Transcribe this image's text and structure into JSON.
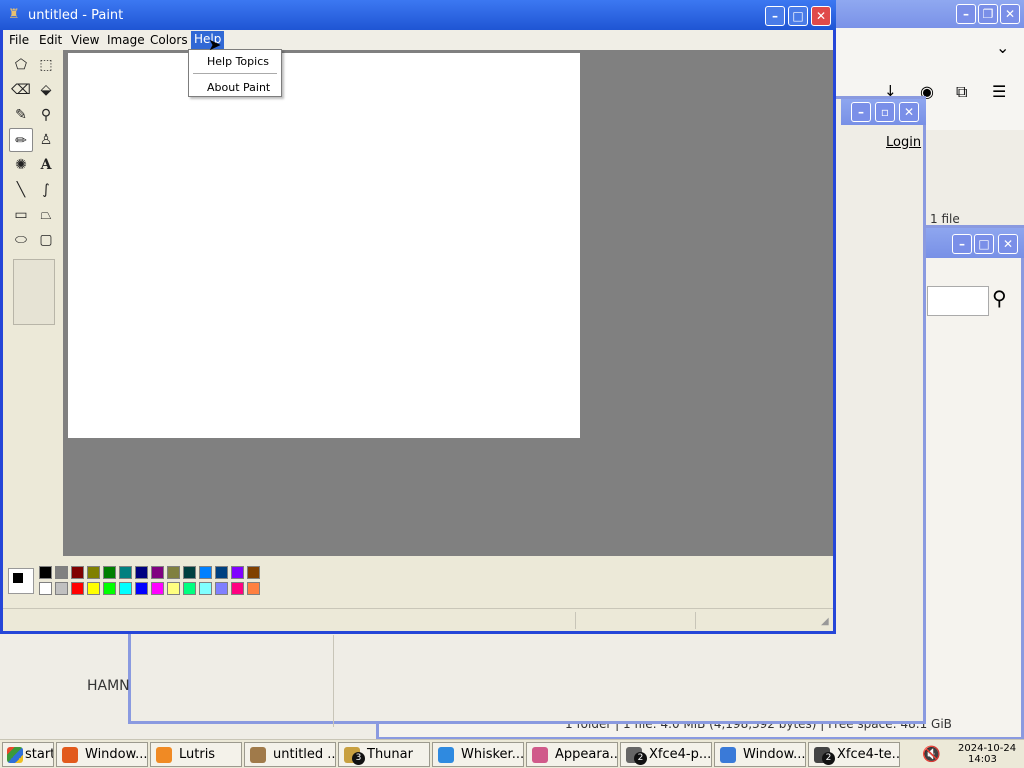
{
  "paint": {
    "title": "untitled - Paint",
    "menus": [
      "File",
      "Edit",
      "View",
      "Image",
      "Colors",
      "Help"
    ],
    "help_menu": [
      "Help Topics",
      "About Paint"
    ]
  },
  "background": {
    "login_label": "Login",
    "file_count": "1 file",
    "hamn_text": "HAMN",
    "status_text": "1 folder  |  1 file: 4.0 MiB (4,198,392 bytes)  |  Free space: 48.1 GiB"
  },
  "palette_colors_top": [
    "#000000",
    "#808080",
    "#800000",
    "#808000",
    "#008000",
    "#008080",
    "#000080",
    "#800080",
    "#808040",
    "#004040",
    "#0080ff",
    "#004080",
    "#8000ff",
    "#804000"
  ],
  "palette_colors_bottom": [
    "#ffffff",
    "#c0c0c0",
    "#ff0000",
    "#ffff00",
    "#00ff00",
    "#00ffff",
    "#0000ff",
    "#ff00ff",
    "#ffff80",
    "#00ff80",
    "#80ffff",
    "#8080ff",
    "#ff0080",
    "#ff8040"
  ],
  "taskbar": {
    "start": "start",
    "tasks": [
      {
        "label": "Window...",
        "color": "#e25a1c",
        "badge": ""
      },
      {
        "label": "Lutris",
        "color": "#f08a24",
        "badge": ""
      },
      {
        "label": "untitled ...",
        "color": "#a07a4a",
        "badge": ""
      },
      {
        "label": "Thunar",
        "color": "#c8a040",
        "badge": "3"
      },
      {
        "label": "Whisker...",
        "color": "#2f8ae0",
        "badge": ""
      },
      {
        "label": "Appeara...",
        "color": "#d05a8a",
        "badge": ""
      },
      {
        "label": "Xfce4-p...",
        "color": "#666666",
        "badge": "2"
      },
      {
        "label": "Window...",
        "color": "#3a7ad8",
        "badge": ""
      },
      {
        "label": "Xfce4-te...",
        "color": "#444444",
        "badge": "2"
      }
    ],
    "date": "2024-10-24",
    "time": "14:03"
  }
}
